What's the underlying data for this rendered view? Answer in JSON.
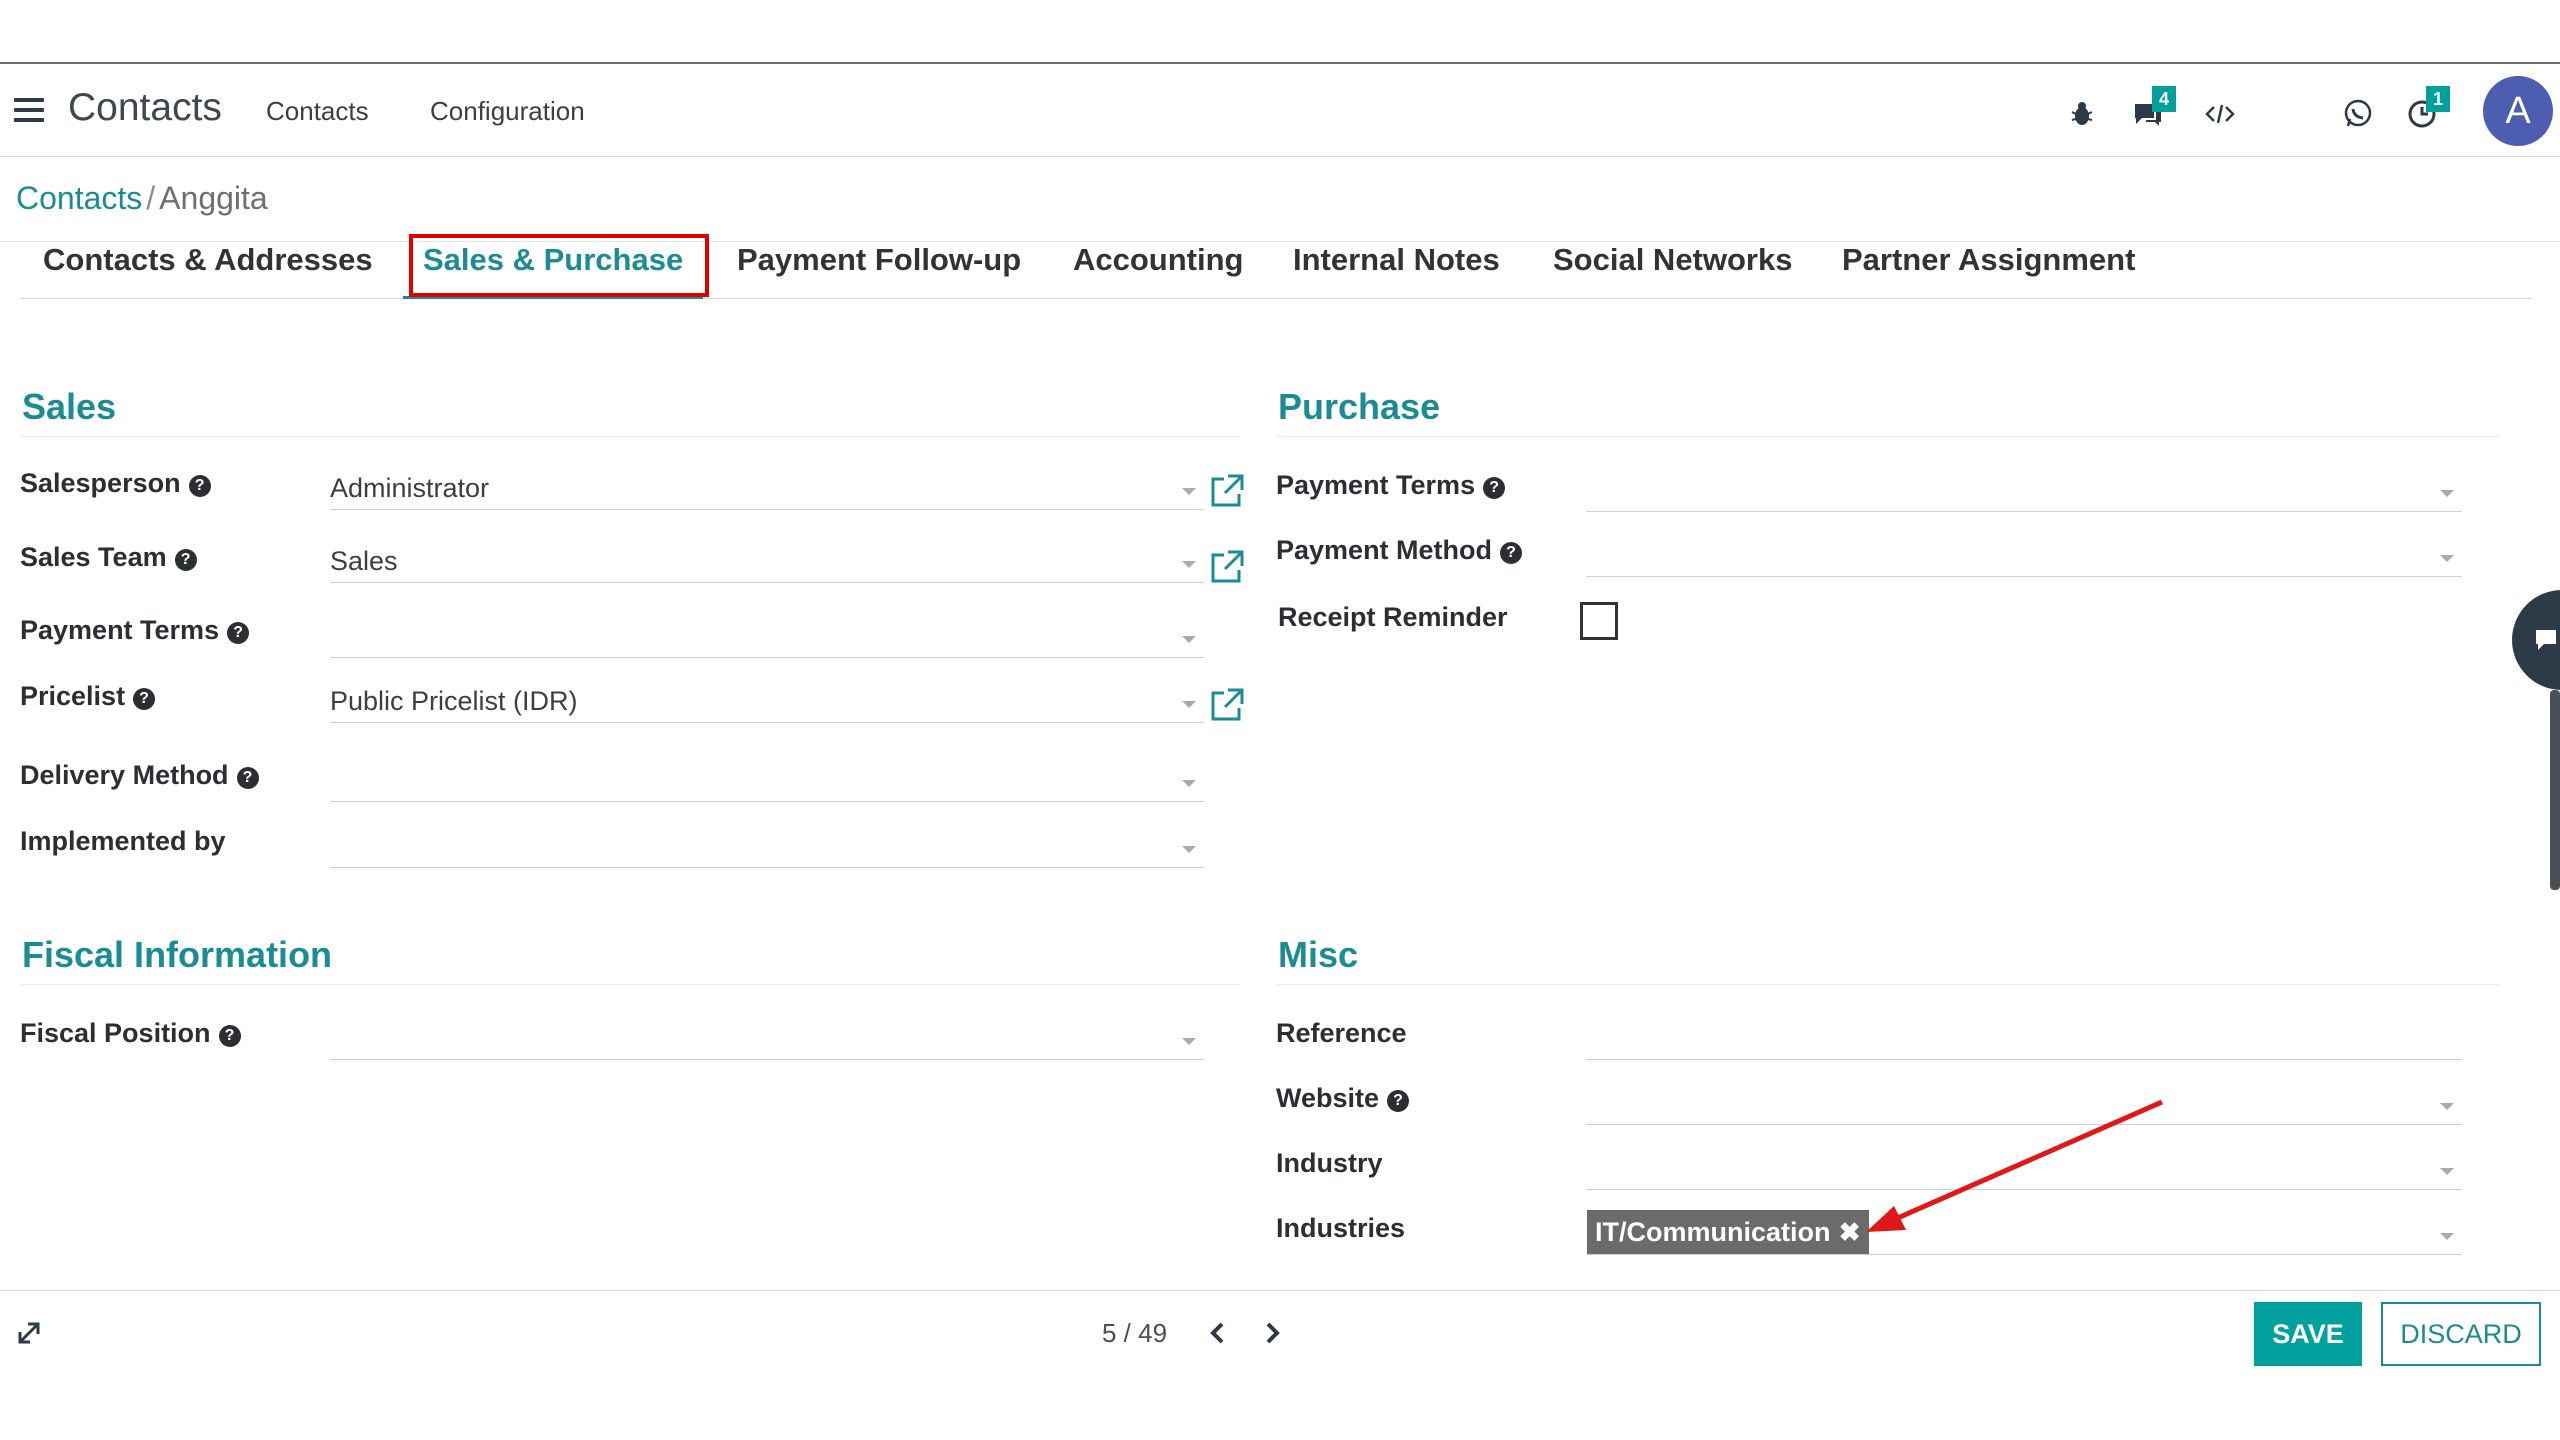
{
  "navbar": {
    "app_title": "Contacts",
    "menu": [
      "Contacts",
      "Configuration"
    ],
    "chat_badge": "4",
    "activity_badge": "1",
    "avatar_letter": "A",
    "accent_color": "#00a09d"
  },
  "breadcrumb": {
    "parent": "Contacts",
    "separator": "/",
    "current": "Anggita"
  },
  "tabs": [
    "Contacts & Addresses",
    "Sales & Purchase",
    "Payment Follow-up",
    "Accounting",
    "Internal Notes",
    "Social Networks",
    "Partner Assignment"
  ],
  "active_tab": "Sales & Purchase",
  "sales": {
    "title": "Sales",
    "fields": [
      {
        "label": "Salesperson",
        "value": "Administrator"
      },
      {
        "label": "Sales Team",
        "value": "Sales"
      },
      {
        "label": "Payment Terms",
        "value": ""
      },
      {
        "label": "Pricelist",
        "value": "Public Pricelist (IDR)"
      },
      {
        "label": "Delivery Method",
        "value": ""
      },
      {
        "label": "Implemented by",
        "value": ""
      }
    ]
  },
  "purchase": {
    "title": "Purchase",
    "fields": [
      {
        "label": "Payment Terms",
        "value": ""
      },
      {
        "label": "Payment Method",
        "value": ""
      },
      {
        "label": "Receipt Reminder",
        "checked": false
      }
    ]
  },
  "fiscal": {
    "title": "Fiscal Information",
    "fields": [
      {
        "label": "Fiscal Position",
        "value": ""
      }
    ]
  },
  "misc": {
    "title": "Misc",
    "fields": [
      {
        "label": "Reference",
        "value": ""
      },
      {
        "label": "Website",
        "value": ""
      },
      {
        "label": "Industry",
        "value": ""
      },
      {
        "label": "Industries",
        "tag": "IT/Communication"
      }
    ]
  },
  "footer": {
    "pager": "5 / 49",
    "save_label": "SAVE",
    "discard_label": "DISCARD"
  },
  "icons": {
    "menu": "hamburger-icon",
    "debug": "bug-icon",
    "chat": "chat-icon",
    "code": "code-icon",
    "whatsapp": "whatsapp-icon",
    "activity": "clock-icon",
    "external": "external-link-icon",
    "help": "question-circle-icon",
    "expand": "expand-icon",
    "prev": "chevron-left-icon",
    "next": "chevron-right-icon"
  }
}
